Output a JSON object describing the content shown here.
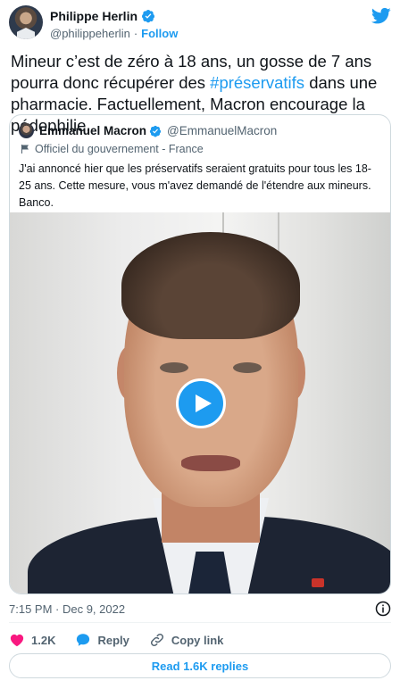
{
  "author": {
    "name": "Philippe Herlin",
    "handle": "@philippeherlin",
    "separator": "·",
    "follow_label": "Follow"
  },
  "tweet": {
    "text_before_hashtag": "Mineur c’est de zéro à 18 ans, un gosse de 7 ans pourra donc récupérer des ",
    "hashtag": "#préservatifs",
    "text_after_hashtag": " dans une pharmacie. Factuellement, Macron encourage la pédophilie."
  },
  "quoted": {
    "name": "Emmanuel Macron",
    "handle": "@EmmanuelMacron",
    "label": "Officiel du gouvernement - France",
    "text": "J'ai annoncé hier que les préservatifs seraient gratuits pour tous les 18-25 ans. Cette mesure, vous m'avez demandé de l'étendre aux mineurs. Banco."
  },
  "meta": {
    "timestamp": "7:15 PM · Dec 9, 2022"
  },
  "actions": {
    "likes": "1.2K",
    "reply_label": "Reply",
    "copy_link_label": "Copy link"
  },
  "read_replies_label": "Read 1.6K replies",
  "colors": {
    "accent": "#1d9bf0",
    "like": "#f91880",
    "text": "#0f1419",
    "muted": "#536471",
    "border": "#cfd9de"
  },
  "icons": [
    "verified-badge-icon",
    "twitter-bird-icon",
    "government-flag-icon",
    "play-icon",
    "info-icon",
    "heart-icon",
    "reply-bubble-icon",
    "link-icon"
  ]
}
